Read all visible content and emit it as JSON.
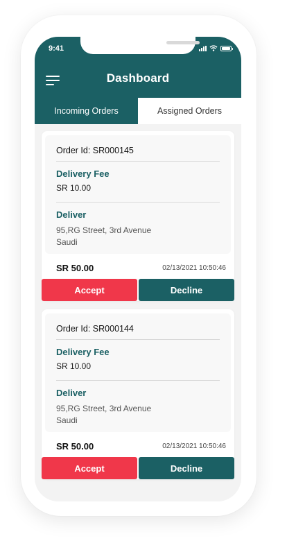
{
  "status_bar": {
    "time": "9:41"
  },
  "header": {
    "title": "Dashboard"
  },
  "tabs": [
    {
      "label": "Incoming Orders",
      "active": true
    },
    {
      "label": "Assigned Orders",
      "active": false
    }
  ],
  "orders": [
    {
      "order_id": "Order Id: SR000145",
      "delivery_fee_label": "Delivery Fee",
      "delivery_fee": "SR 10.00",
      "deliver_label": "Deliver",
      "address_line1": "95,RG Street, 3rd Avenue",
      "address_line2": "Saudi",
      "total": "SR 50.00",
      "datetime": "02/13/2021  10:50:46",
      "accept_label": "Accept",
      "decline_label": "Decline"
    },
    {
      "order_id": "Order Id: SR000144",
      "delivery_fee_label": "Delivery Fee",
      "delivery_fee": "SR 10.00",
      "deliver_label": "Deliver",
      "address_line1": "95,RG Street, 3rd Avenue",
      "address_line2": "Saudi",
      "total": "SR 50.00",
      "datetime": "02/13/2021  10:50:46",
      "accept_label": "Accept",
      "decline_label": "Decline"
    }
  ],
  "colors": {
    "primary": "#1b6064",
    "accept": "#f0374a",
    "background": "#f3f3f3"
  }
}
